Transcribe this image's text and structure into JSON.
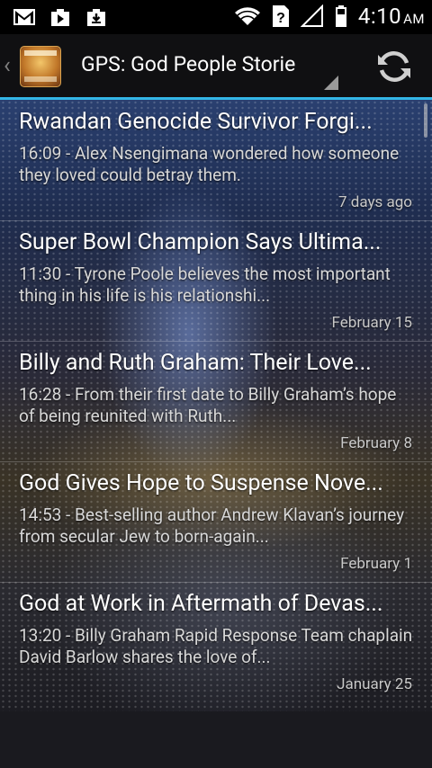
{
  "status_bar": {
    "icons_left": [
      "gmail-icon",
      "play-store-icon",
      "shopping-bag-icon"
    ],
    "icons_right": [
      "wifi-icon",
      "no-sim-icon",
      "signal-icon",
      "battery-icon"
    ],
    "time": "4:10",
    "ampm": "AM"
  },
  "action_bar": {
    "title": "GPS: God People Storie",
    "refresh_icon": "refresh-icon",
    "accent_color": "#33b5e5"
  },
  "stories": [
    {
      "title": "Rwandan Genocide Survivor Forgi...",
      "description": "16:09 - Alex Nsengimana wondered how someone they loved could betray them.",
      "date": "7 days ago"
    },
    {
      "title": "Super Bowl Champion Says Ultima...",
      "description": "11:30 - Tyrone Poole believes the most important thing in his life is his relationshi...",
      "date": "February 15"
    },
    {
      "title": "Billy and Ruth Graham: Their Love...",
      "description": "16:28 - From their first date to Billy Graham’s hope of being reunited with Ruth...",
      "date": "February 8"
    },
    {
      "title": "God Gives Hope to Suspense Nove...",
      "description": "14:53 - Best-selling author Andrew Klavan’s journey from secular Jew to born-again...",
      "date": "February 1"
    },
    {
      "title": "God at Work in Aftermath of Devas...",
      "description": "13:20 - Billy Graham Rapid Response Team chaplain David Barlow shares the love of...",
      "date": "January 25"
    }
  ]
}
